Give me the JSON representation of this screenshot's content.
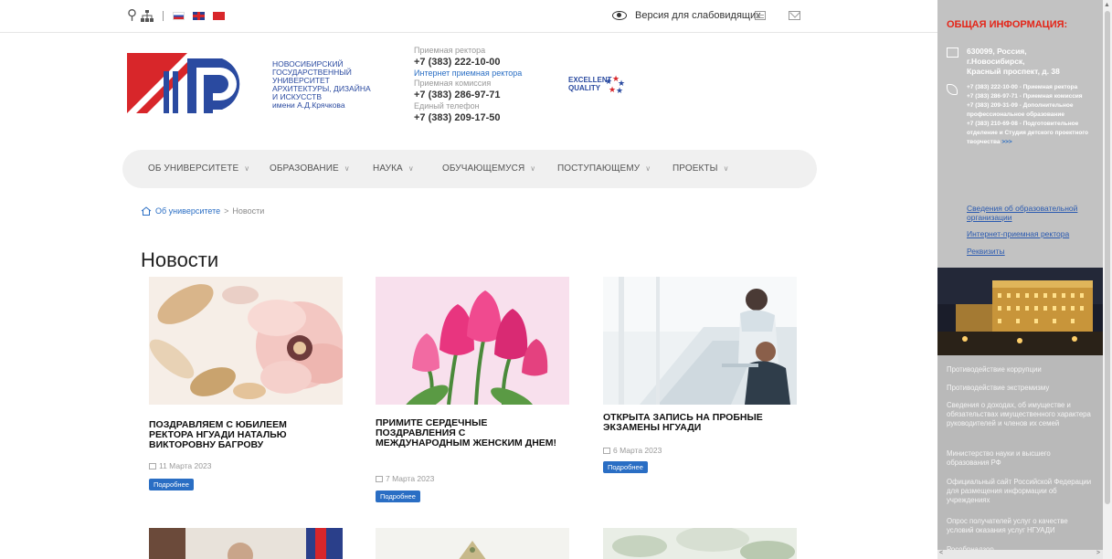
{
  "topbar": {
    "accessibility_label": "Версия для слабовидящих"
  },
  "header": {
    "uni_name_lines": [
      "НОВОСИБИРСКИЙ",
      "ГОСУДАРСТВЕННЫЙ",
      "УНИВЕРСИТЕТ",
      "АРХИТЕКТУРЫ, ДИЗАЙНА",
      "И ИСКУССТВ",
      "имени А.Д.Крячкова"
    ],
    "contacts": {
      "rector_label": "Приемная ректора",
      "rector_phone": "+7 (383) 222-10-00",
      "rector_online_link": "Интернет приемная ректора",
      "admission_label": "Приемная комиссия",
      "admission_phone": "+7 (383) 286-97-71",
      "single_label": "Единый телефон",
      "single_phone": "+7 (383) 209-17-50"
    },
    "eq_logo_text": [
      "EXCELLENT",
      "QUALITY"
    ]
  },
  "nav": {
    "items": [
      {
        "label": "ОБ УНИВЕРСИТЕТЕ"
      },
      {
        "label": "ОБРАЗОВАНИЕ"
      },
      {
        "label": "НАУКА"
      },
      {
        "label": "ОБУЧАЮЩЕМУСЯ"
      },
      {
        "label": "ПОСТУПАЮЩЕМУ"
      },
      {
        "label": "ПРОЕКТЫ"
      }
    ]
  },
  "breadcrumb": {
    "parent": "Об университете",
    "separator": ">",
    "current": "Новости"
  },
  "page_title": "Новости",
  "news": [
    {
      "title": "ПОЗДРАВЛЯЕМ С ЮБИЛЕЕМ РЕКТОРА НГУАДИ НАТАЛЬЮ ВИКТОРОВНУ БАГРОВУ",
      "date": "11 Марта 2023",
      "button": "Подробнее"
    },
    {
      "title": "ПРИМИТЕ СЕРДЕЧНЫЕ ПОЗДРАВЛЕНИЯ С МЕЖДУНАРОДНЫМ ЖЕНСКИМ ДНЕМ!",
      "date": "7 Марта 2023",
      "button": "Подробнее"
    },
    {
      "title": "ОТКРЫТА ЗАПИСЬ НА ПРОБНЫЕ ЭКЗАМЕНЫ НГУАДИ",
      "date": "6 Марта 2023",
      "button": "Подробнее"
    }
  ],
  "sidebar": {
    "title": "ОБЩАЯ ИНФОРМАЦИЯ:",
    "address": [
      "630099, Россия,",
      "г.Новосибирск,",
      "Красный проспект, д. 38"
    ],
    "phones": [
      "+7 (383) 222-10-00 - Приемная ректора",
      "+7 (383) 286-97-71 - Приемная комиссия",
      "+7 (383) 209-31-09 - Дополнительное профессиональное образование",
      "+7 (383) 210-69-08 - Подготовительное отделение и Студия детского проектного творчества"
    ],
    "phones_more": ">>>",
    "links": [
      "Сведения об образовательной организации",
      "Интернет-приемная ректора",
      "Реквизиты"
    ],
    "bottom_items": [
      "Противодействие коррупции",
      "Противодействие экстремизму",
      "Сведения о доходах, об имуществе и обязательствах имущественного характера руководителей и членов их семей",
      "Министерство науки и высшего образования РФ",
      "Официальный сайт Российской Федерации для размещения информации об учреждениях",
      "Опрос получателей услуг о качестве условий оказания услуг НГУАДИ",
      "Рособрнадзор"
    ]
  },
  "colors": {
    "accent_red": "#e42518",
    "link_blue": "#2a6ec4",
    "sidebar_bg": "#c2c2c2"
  }
}
